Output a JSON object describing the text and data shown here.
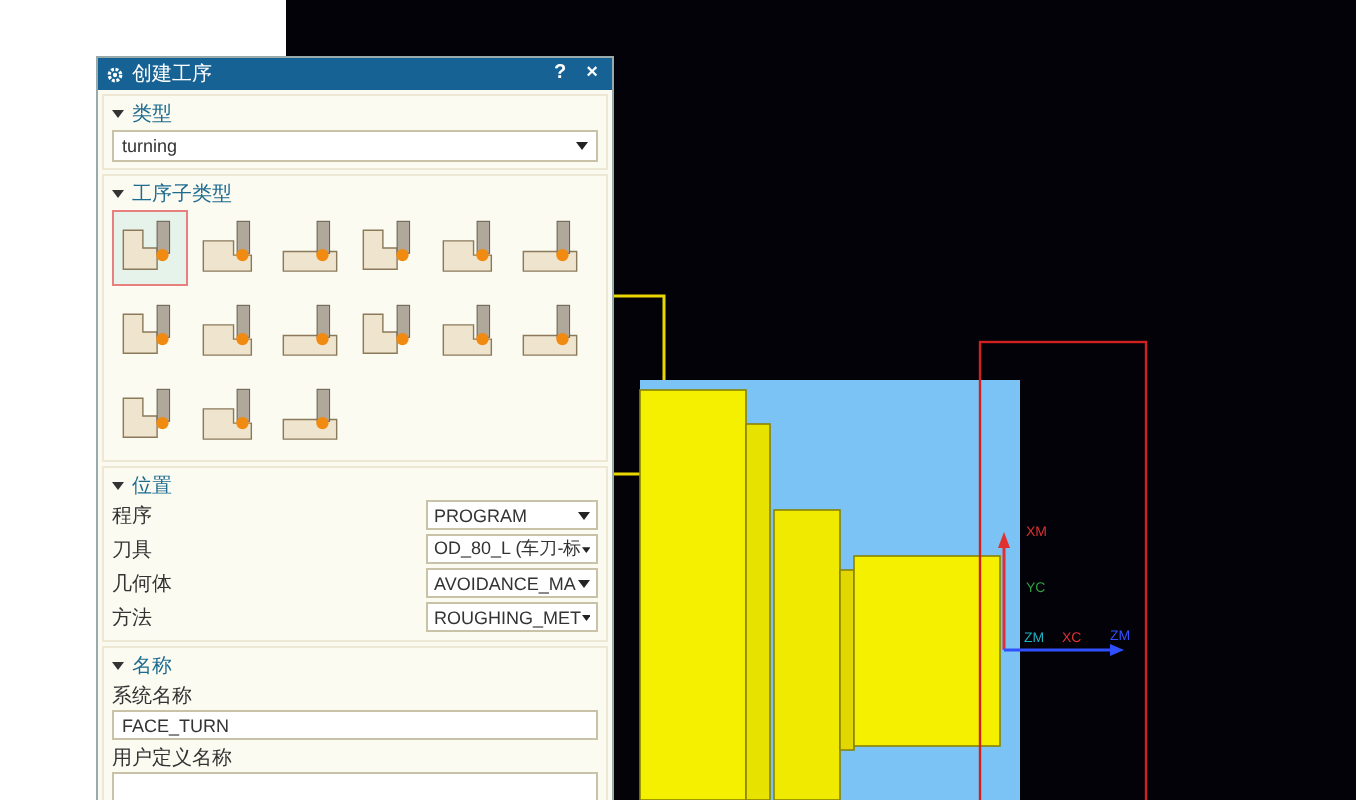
{
  "dialog": {
    "title": "创建工序",
    "title_buttons": [
      "?",
      "×"
    ],
    "type_section": {
      "header": "类型",
      "expanded": true,
      "value": "turning"
    },
    "subtype_section": {
      "header": "工序子类型",
      "expanded": true,
      "items": [
        {
          "selected": true
        },
        {
          "selected": false
        },
        {
          "selected": false
        },
        {
          "selected": false
        },
        {
          "selected": false
        },
        {
          "selected": false
        },
        {
          "selected": false
        },
        {
          "selected": false
        },
        {
          "selected": false
        },
        {
          "selected": false
        },
        {
          "selected": false
        },
        {
          "selected": false
        },
        {
          "selected": false
        },
        {
          "selected": false
        },
        {
          "selected": false
        }
      ]
    },
    "location_section": {
      "header": "位置",
      "expanded": true,
      "rows": [
        {
          "label": "程序",
          "value": "PROGRAM"
        },
        {
          "label": "刀具",
          "value": "OD_80_L (车刀-标"
        },
        {
          "label": "几何体",
          "value": "AVOIDANCE_MA"
        },
        {
          "label": "方法",
          "value": "ROUGHING_MET"
        }
      ]
    },
    "name_section": {
      "header": "名称",
      "expanded": true,
      "system_name_label": "系统名称",
      "system_name": "FACE_TURN",
      "user_name_label": "用户定义名称"
    }
  },
  "viewport": {
    "axis_labels": [
      {
        "text": "XM",
        "color": "#e03030"
      },
      {
        "text": "YC",
        "color": "#30a040"
      },
      {
        "text": "ZM",
        "color": "#20b0c0"
      },
      {
        "text": "XC",
        "color": "#e03030"
      },
      {
        "text": "ZM",
        "color": "#3050ff"
      }
    ]
  }
}
